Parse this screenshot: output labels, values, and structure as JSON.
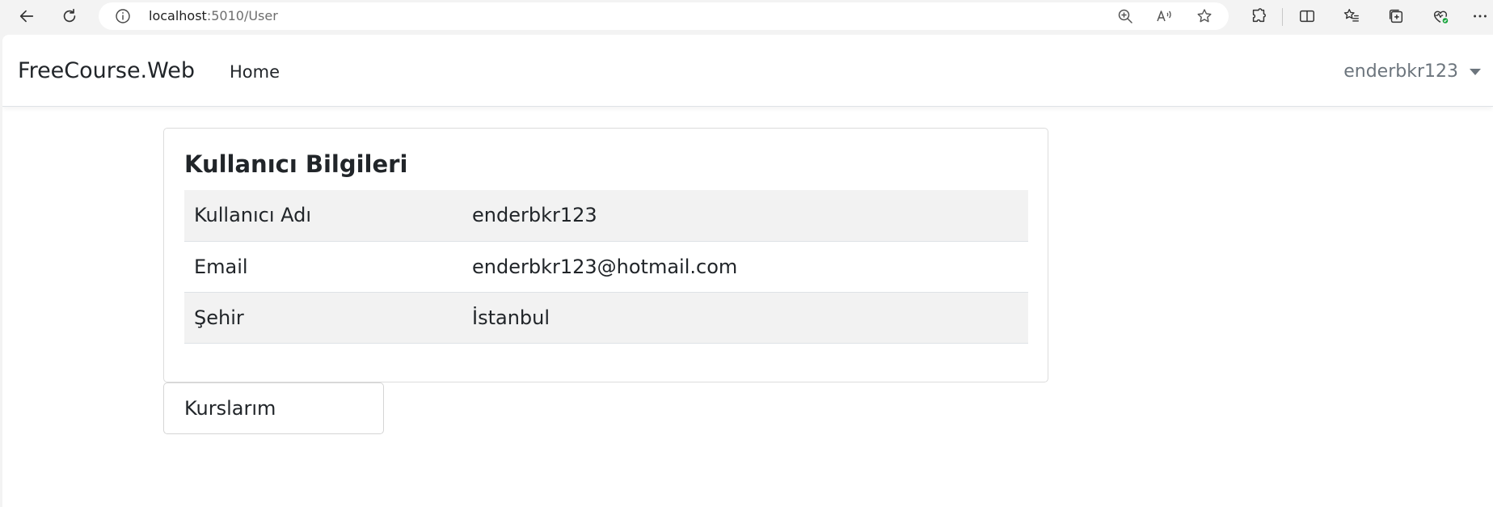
{
  "browser": {
    "url_host": "localhost",
    "url_path": ":5010/User",
    "icons": [
      "back-icon",
      "refresh-icon",
      "info-icon",
      "zoom-icon",
      "read-aloud-icon",
      "favorite-star-icon",
      "extensions-icon",
      "split-screen-icon",
      "favorites-icon",
      "collections-icon",
      "browser-essentials-icon",
      "more-icon"
    ]
  },
  "navbar": {
    "brand": "FreeCourse.Web",
    "home": "Home",
    "user": "enderbkr123"
  },
  "card": {
    "title": "Kullanıcı Bilgileri",
    "rows": [
      {
        "label": "Kullanıcı Adı",
        "value": "enderbkr123"
      },
      {
        "label": "Email",
        "value": "enderbkr123@hotmail.com"
      },
      {
        "label": "Şehir",
        "value": "İstanbul"
      }
    ]
  },
  "courses_button": "Kurslarım"
}
